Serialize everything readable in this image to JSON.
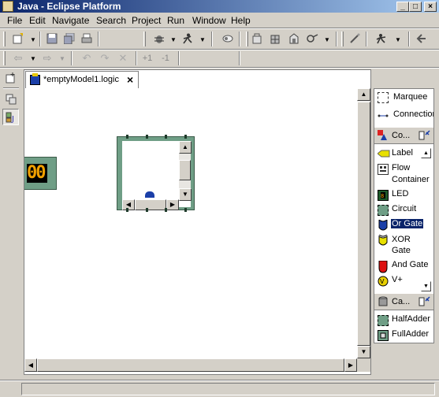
{
  "window": {
    "title": "Java - Eclipse Platform",
    "controls": {
      "minimize": "_",
      "maximize": "□",
      "close": "×"
    }
  },
  "menu": [
    "File",
    "Edit",
    "Navigate",
    "Search",
    "Project",
    "Run",
    "Window",
    "Help"
  ],
  "editor": {
    "tab_label": "*emptyModel1.logic",
    "tab_close": "×",
    "led_display": "00"
  },
  "palette": {
    "tools": [
      {
        "label": "Marquee",
        "icon": "marquee-icon"
      },
      {
        "label": "Connection",
        "icon": "connection-icon"
      }
    ],
    "drawers": [
      {
        "label": "Co...",
        "icon": "components-drawer-icon",
        "items": [
          {
            "label": "Label",
            "icon": "label-icon"
          },
          {
            "label": "Flow",
            "label2": "Container",
            "icon": "flow-container-icon"
          },
          {
            "label": "LED",
            "icon": "led-icon"
          },
          {
            "label": "Circuit",
            "icon": "circuit-icon"
          },
          {
            "label": "Or Gate",
            "icon": "or-gate-icon",
            "selected": true
          },
          {
            "label": "XOR",
            "label2": "Gate",
            "icon": "xor-gate-icon"
          },
          {
            "label": "And Gate",
            "icon": "and-gate-icon"
          },
          {
            "label": "V+",
            "icon": "vplus-icon"
          }
        ]
      },
      {
        "label": "Ca...",
        "icon": "canned-parts-drawer-icon",
        "items": [
          {
            "label": "HalfAdder",
            "icon": "half-adder-icon"
          },
          {
            "label": "FullAdder",
            "icon": "full-adder-icon"
          }
        ]
      }
    ]
  },
  "toolbar2": {
    "prev_annotation": "+1",
    "next_annotation": "-1"
  },
  "colors": {
    "title_gradient_start": "#0a246a",
    "title_gradient_end": "#a6caf0",
    "circuit_green": "#6f9e86",
    "selection": "#0a246a"
  }
}
